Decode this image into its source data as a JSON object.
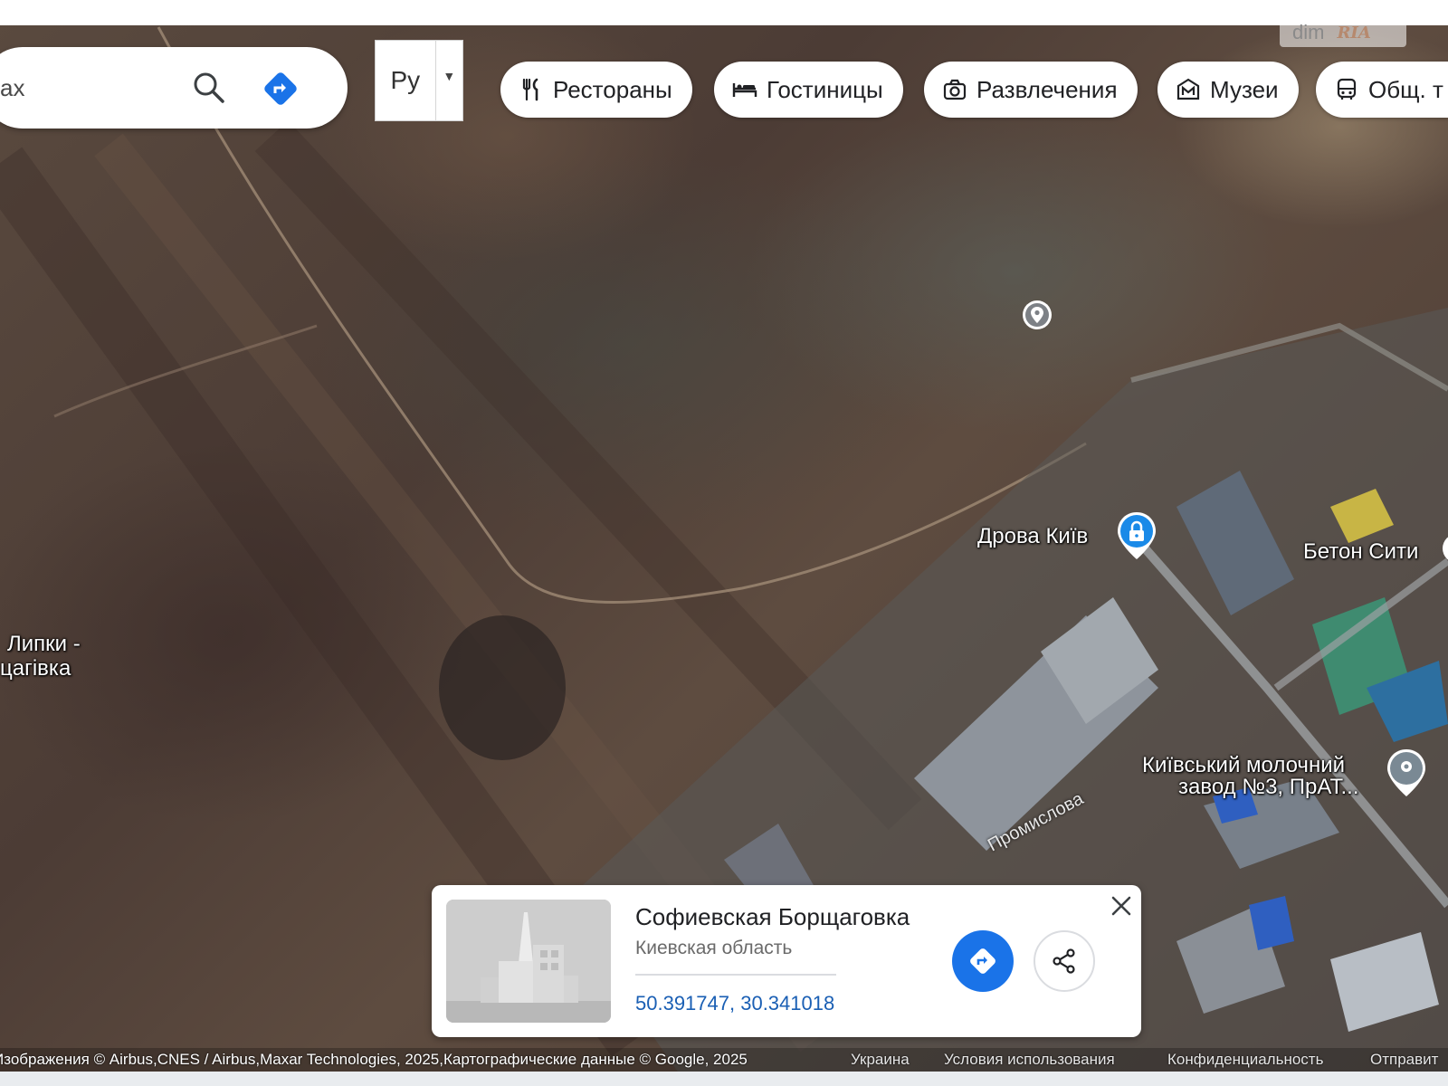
{
  "watermark": {
    "dim": "dim",
    "ria": "RIA"
  },
  "search": {
    "value": "ax"
  },
  "language": {
    "selected": "Ру"
  },
  "chips": [
    {
      "label": "Рестораны",
      "icon": "fork-knife-icon"
    },
    {
      "label": "Гостиницы",
      "icon": "bed-icon"
    },
    {
      "label": "Развлечения",
      "icon": "camera-icon"
    },
    {
      "label": "Музеи",
      "icon": "museum-icon"
    },
    {
      "label": "Общ. т",
      "icon": "bus-icon"
    }
  ],
  "map": {
    "labels": {
      "lipki_line1": "Липки -",
      "lipki_line2": "цагівка",
      "drova": "Дрова Київ",
      "beton": "Бетон Сити",
      "zavod_line1": "Київський молочний",
      "zavod_line2": "завод №3, ПрАТ...",
      "street": "Промислова"
    }
  },
  "card": {
    "title": "Софиевская Борщаговка",
    "subtitle": "Киевская область",
    "coordinates": "50.391747, 30.341018"
  },
  "attribution": {
    "main": "Изображения © Airbus,CNES / Airbus,Maxar Technologies, 2025,Картографические данные © Google, 2025",
    "country": "Украина",
    "terms": "Условия использования",
    "privacy": "Конфиденциальность",
    "feedback": "Отправит"
  },
  "colors": {
    "accent": "#1a73e8",
    "link": "#1a5fb4"
  }
}
